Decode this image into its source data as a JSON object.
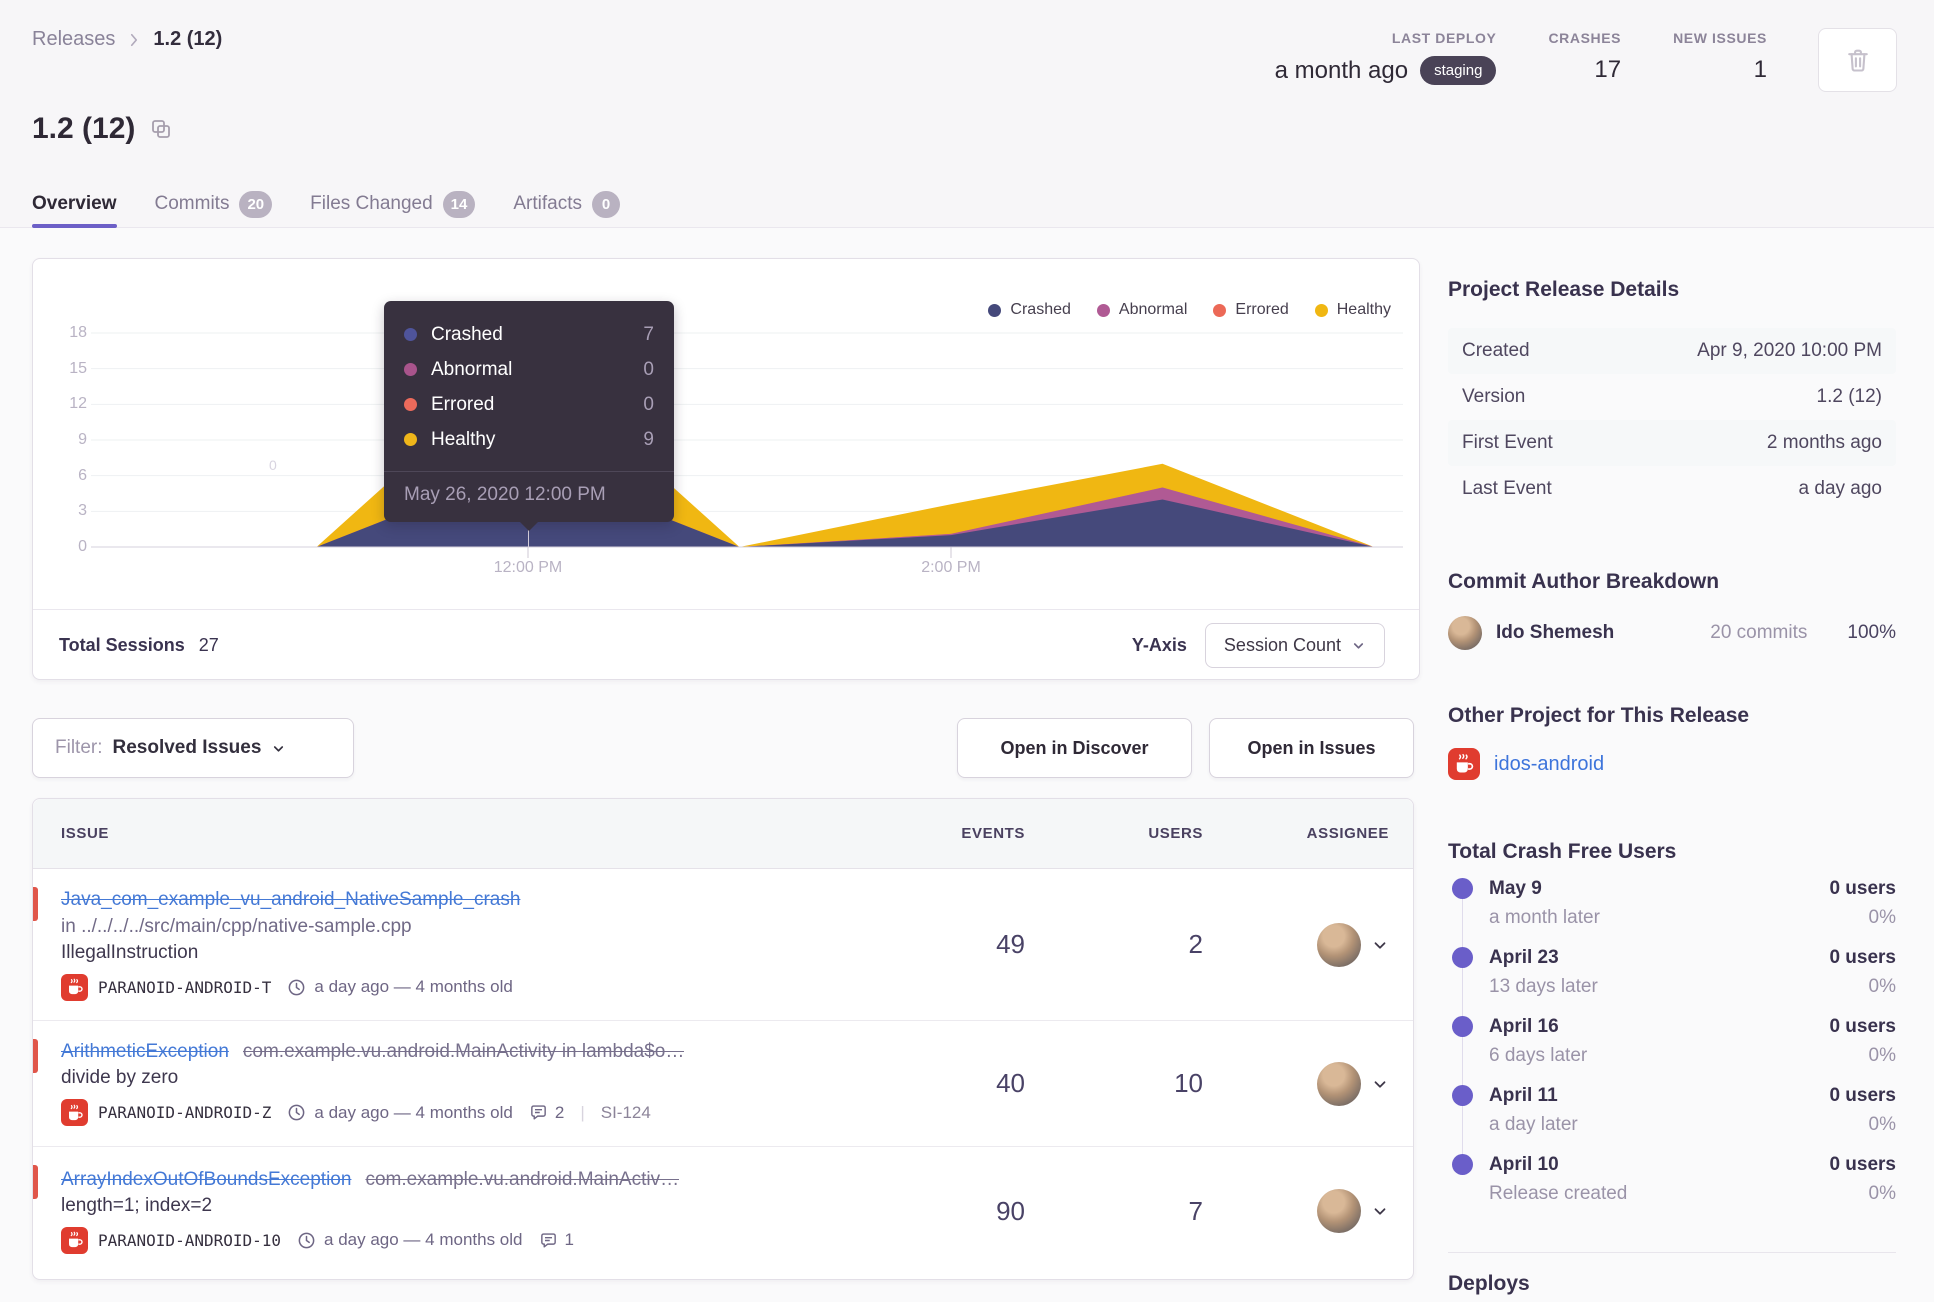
{
  "breadcrumb": {
    "parent": "Releases",
    "current": "1.2 (12)"
  },
  "header": {
    "title": "1.2 (12)",
    "last_deploy_label": "LAST DEPLOY",
    "last_deploy_value": "a month ago",
    "last_deploy_env": "staging",
    "crashes_label": "CRASHES",
    "crashes_value": "17",
    "new_issues_label": "NEW ISSUES",
    "new_issues_value": "1"
  },
  "tabs": [
    {
      "label": "Overview"
    },
    {
      "label": "Commits",
      "badge": "20"
    },
    {
      "label": "Files Changed",
      "badge": "14"
    },
    {
      "label": "Artifacts",
      "badge": "0"
    }
  ],
  "chart": {
    "y_tick_labels": [
      "18",
      "15",
      "12",
      "9",
      "6",
      "3",
      "0"
    ],
    "x_tick_labels": [
      "12:00 PM",
      "2:00 PM"
    ],
    "stray_label": "0",
    "tooltip": {
      "rows": [
        {
          "label": "Crashed",
          "value": "7",
          "color": "#4f549b"
        },
        {
          "label": "Abnormal",
          "value": "0",
          "color": "#a9548c"
        },
        {
          "label": "Errored",
          "value": "0",
          "color": "#ec6a5b"
        },
        {
          "label": "Healthy",
          "value": "9",
          "color": "#efb61a"
        }
      ],
      "date": "May 26, 2020 12:00 PM"
    },
    "footer": {
      "total_label": "Total Sessions",
      "total_value": "27",
      "yaxis_label": "Y-Axis",
      "yaxis_value": "Session Count"
    }
  },
  "chart_data": {
    "type": "area",
    "stacked": true,
    "x": [
      "11:00 AM",
      "12:00 PM",
      "1:00 PM",
      "2:00 PM",
      "3:00 PM",
      "4:00 PM"
    ],
    "x_hours": [
      11,
      12,
      13,
      14,
      15,
      16
    ],
    "series": [
      {
        "name": "Crashed",
        "color": "#45497b",
        "values": [
          0,
          7,
          0,
          1,
          4,
          0
        ]
      },
      {
        "name": "Abnormal",
        "color": "#b05a94",
        "values": [
          0,
          0,
          0,
          0.1,
          1,
          0
        ]
      },
      {
        "name": "Errored",
        "color": "#ec6957",
        "values": [
          0,
          0,
          0,
          0,
          0,
          0
        ]
      },
      {
        "name": "Healthy",
        "color": "#f0b712",
        "values": [
          0,
          9,
          0,
          2.5,
          2,
          0
        ]
      }
    ],
    "y_ticks": [
      0,
      3,
      6,
      9,
      12,
      15,
      18
    ],
    "ylim": [
      0,
      18
    ],
    "x_label_hours": [
      12,
      14
    ],
    "legend_position": "top-right",
    "grid": "horizontal",
    "tooltip_point": {
      "x": "12:00 PM",
      "crashed": 7,
      "abnormal": 0,
      "errored": 0,
      "healthy": 9
    },
    "total_sessions": 27
  },
  "toolbar": {
    "filter_label": "Filter:",
    "filter_value": "Resolved Issues",
    "open_discover": "Open in Discover",
    "open_issues": "Open in Issues"
  },
  "issues": {
    "columns": [
      "ISSUE",
      "EVENTS",
      "USERS",
      "ASSIGNEE"
    ],
    "rows": [
      {
        "title": "Java_com_example_vu_android_NativeSample_crash",
        "location": "in ../../../../src/main/cpp/native-sample.cpp",
        "message": "IllegalInstruction",
        "project": "PARANOID-ANDROID-T",
        "age": "a day ago — 4 months old",
        "events": "49",
        "users": "2"
      },
      {
        "title": "ArithmeticException",
        "culprit": "com.example.vu.android.MainActivity in lambda$o…",
        "message": "divide by zero",
        "project": "PARANOID-ANDROID-Z",
        "age": "a day ago — 4 months old",
        "comments": "2",
        "tracker": "SI-124",
        "events": "40",
        "users": "10"
      },
      {
        "title": "ArrayIndexOutOfBoundsException",
        "culprit": "com.example.vu.android.MainActiv…",
        "message": "length=1; index=2",
        "project": "PARANOID-ANDROID-10",
        "age": "a day ago — 4 months old",
        "comments": "1",
        "events": "90",
        "users": "7"
      }
    ]
  },
  "sidebar": {
    "release_details": {
      "heading": "Project Release Details",
      "rows": [
        {
          "label": "Created",
          "value": "Apr 9, 2020 10:00 PM"
        },
        {
          "label": "Version",
          "value": "1.2 (12)"
        },
        {
          "label": "First Event",
          "value": "2 months ago"
        },
        {
          "label": "Last Event",
          "value": "a day ago"
        }
      ]
    },
    "commit_authors": {
      "heading": "Commit Author Breakdown",
      "author": "Ido Shemesh",
      "commits": "20 commits",
      "percent": "100%"
    },
    "other_project": {
      "heading": "Other Project for This Release",
      "project": "idos-android"
    },
    "crash_free": {
      "heading": "Total Crash Free Users",
      "items": [
        {
          "date": "May 9",
          "sub": "a month later",
          "users": "0 users",
          "pct": "0%"
        },
        {
          "date": "April 23",
          "sub": "13 days later",
          "users": "0 users",
          "pct": "0%"
        },
        {
          "date": "April 16",
          "sub": "6 days later",
          "users": "0 users",
          "pct": "0%"
        },
        {
          "date": "April 11",
          "sub": "a day later",
          "users": "0 users",
          "pct": "0%"
        },
        {
          "date": "April 10",
          "sub": "Release created",
          "users": "0 users",
          "pct": "0%"
        }
      ]
    },
    "deploys_heading": "Deploys"
  }
}
